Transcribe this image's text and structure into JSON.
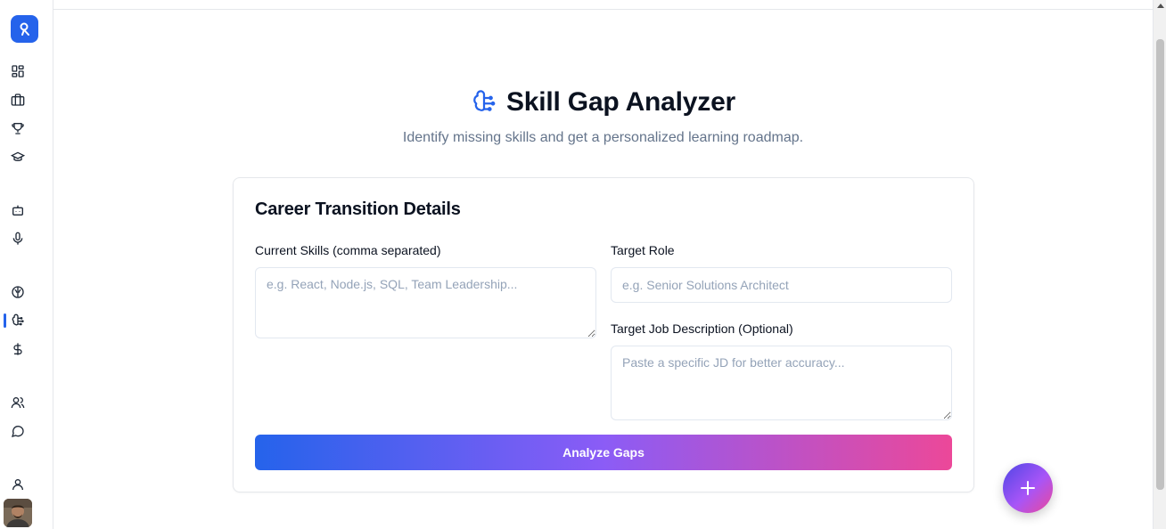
{
  "header": {
    "title": "Skill Gap Analyzer",
    "subtitle": "Identify missing skills and get a personalized learning roadmap."
  },
  "form": {
    "card_title": "Career Transition Details",
    "current_skills_label": "Current Skills (comma separated)",
    "current_skills_placeholder": "e.g. React, Node.js, SQL, Team Leadership...",
    "current_skills_value": "",
    "target_role_label": "Target Role",
    "target_role_placeholder": "e.g. Senior Solutions Architect",
    "target_role_value": "",
    "job_description_label": "Target Job Description (Optional)",
    "job_description_placeholder": "Paste a specific JD for better accuracy...",
    "job_description_value": "",
    "submit_label": "Analyze Gaps"
  },
  "sidebar": {
    "items": [
      {
        "icon": "dashboard-icon"
      },
      {
        "icon": "briefcase-icon"
      },
      {
        "icon": "trophy-icon"
      },
      {
        "icon": "graduation-cap-icon"
      },
      {
        "icon": "bot-icon"
      },
      {
        "icon": "microphone-icon"
      },
      {
        "icon": "brain-icon"
      },
      {
        "icon": "brain-circuit-icon",
        "active": true
      },
      {
        "icon": "dollar-icon"
      },
      {
        "icon": "users-icon"
      },
      {
        "icon": "chat-icon"
      },
      {
        "icon": "user-icon"
      }
    ]
  },
  "colors": {
    "accent": "#2563eb",
    "gradient_start": "#2563eb",
    "gradient_mid": "#8b5cf6",
    "gradient_end": "#ec4899"
  }
}
